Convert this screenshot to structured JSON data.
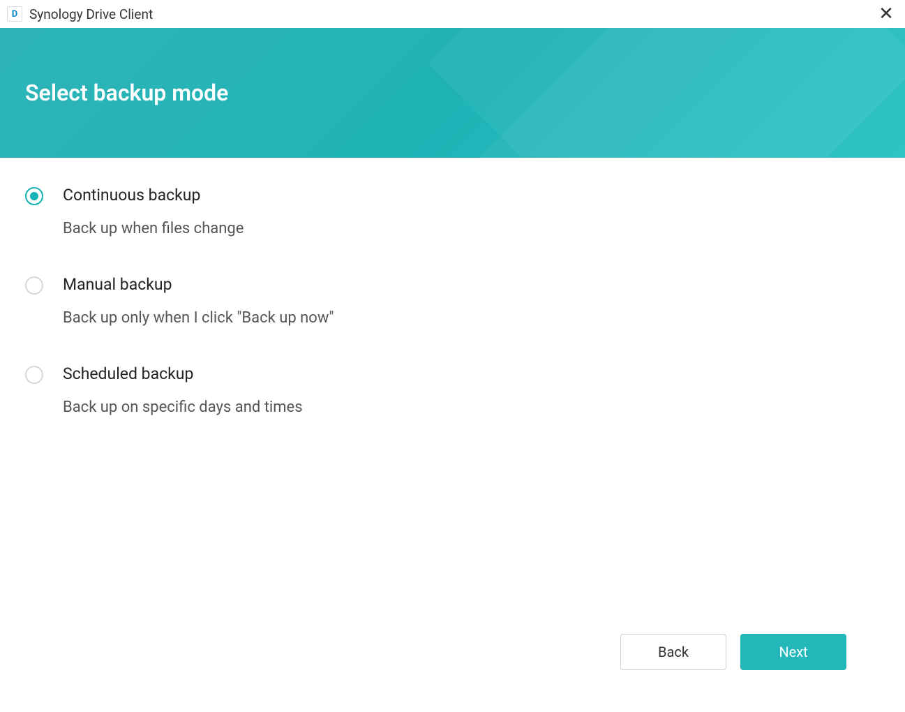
{
  "titlebar": {
    "icon_letter": "D",
    "app_title": "Synology Drive Client"
  },
  "header": {
    "title": "Select backup mode"
  },
  "options": [
    {
      "id": "continuous",
      "label": "Continuous backup",
      "description": "Back up when files change",
      "selected": true
    },
    {
      "id": "manual",
      "label": "Manual backup",
      "description": "Back up only when I click \"Back up now\"",
      "selected": false
    },
    {
      "id": "scheduled",
      "label": "Scheduled backup",
      "description": "Back up on specific days and times",
      "selected": false
    }
  ],
  "footer": {
    "back_label": "Back",
    "next_label": "Next"
  }
}
